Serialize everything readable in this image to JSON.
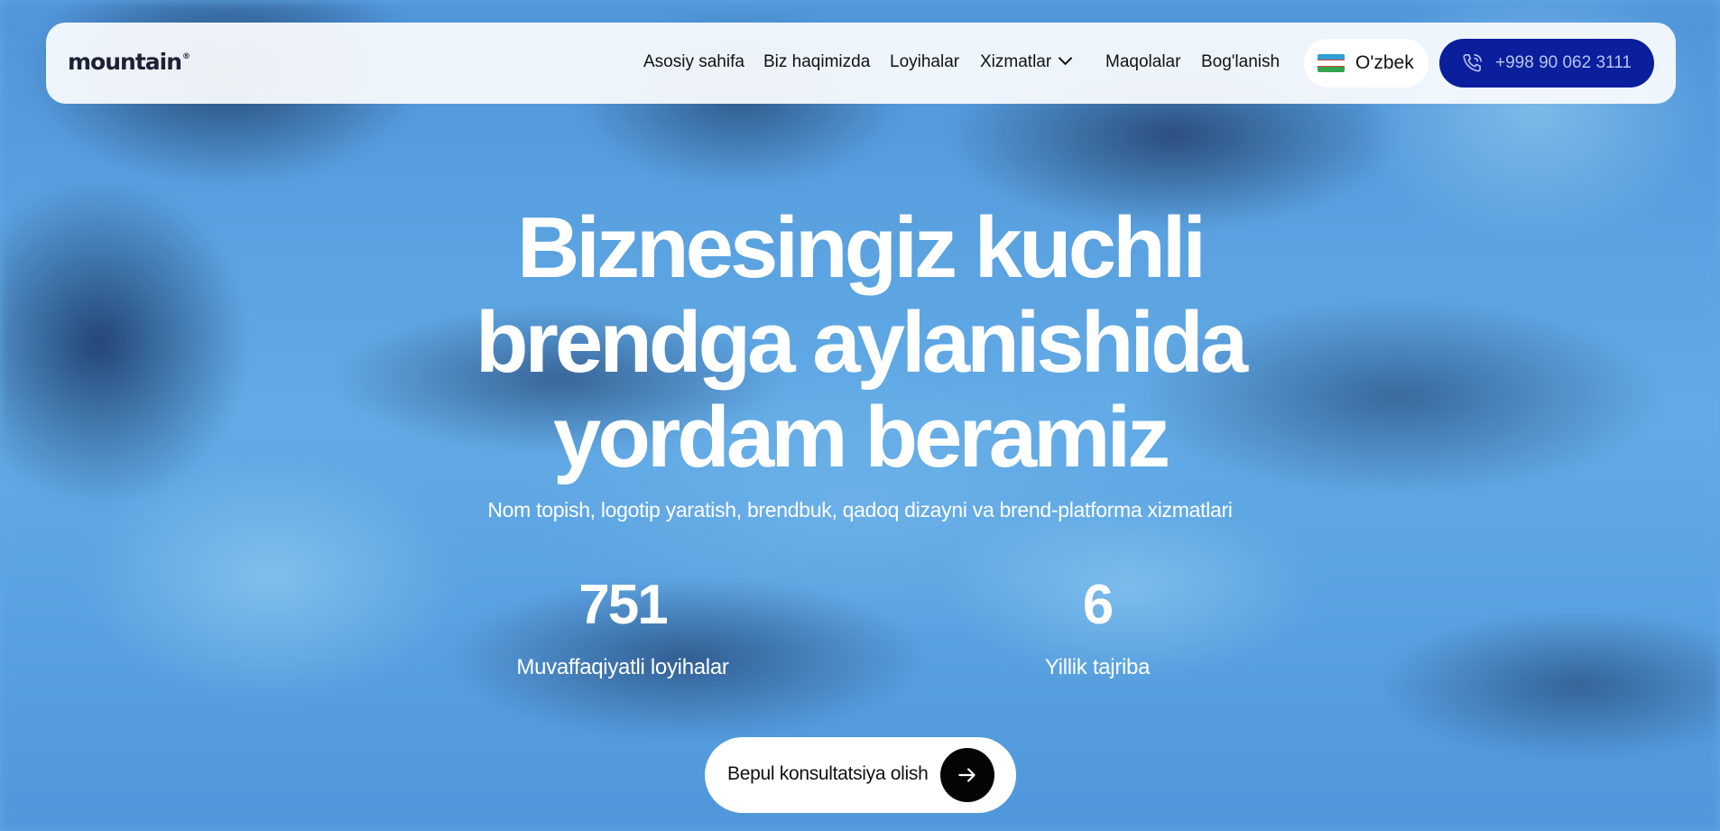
{
  "header": {
    "logo": "mountain",
    "logo_mark": "®",
    "nav": [
      {
        "label": "Asosiy sahifa"
      },
      {
        "label": "Biz haqimizda"
      },
      {
        "label": "Loyihalar"
      },
      {
        "label": "Xizmatlar",
        "icon": "chevron-down-icon"
      },
      {
        "label": "Maqolalar"
      },
      {
        "label": "Bog'lanish"
      }
    ],
    "language": {
      "label": "O'zbek",
      "icon": "uzbekistan-flag-icon"
    },
    "phone": {
      "label": "+998 90 062 3111",
      "icon": "phone-icon"
    }
  },
  "hero": {
    "title_lines": [
      "Biznesingiz kuchli",
      "brendga aylanishida",
      "yordam beramiz"
    ],
    "subtitle": "Nom topish, logotip yaratish, brendbuk, qadoq dizayni va brend-platforma xizmatlari",
    "stats": [
      {
        "value": "751",
        "label": "Muvaffaqiyatli loyihalar"
      },
      {
        "value": "6",
        "label": "Yillik tajriba"
      }
    ],
    "cta": {
      "label": "Bepul konsultatsiya olish",
      "icon": "arrow-right-icon"
    }
  },
  "colors": {
    "primary": "#0b1f9c",
    "background": "#5fa7e4",
    "header_bg": "#f7fafd",
    "text_dark": "#111111",
    "cta_icon_bg": "#050505"
  }
}
